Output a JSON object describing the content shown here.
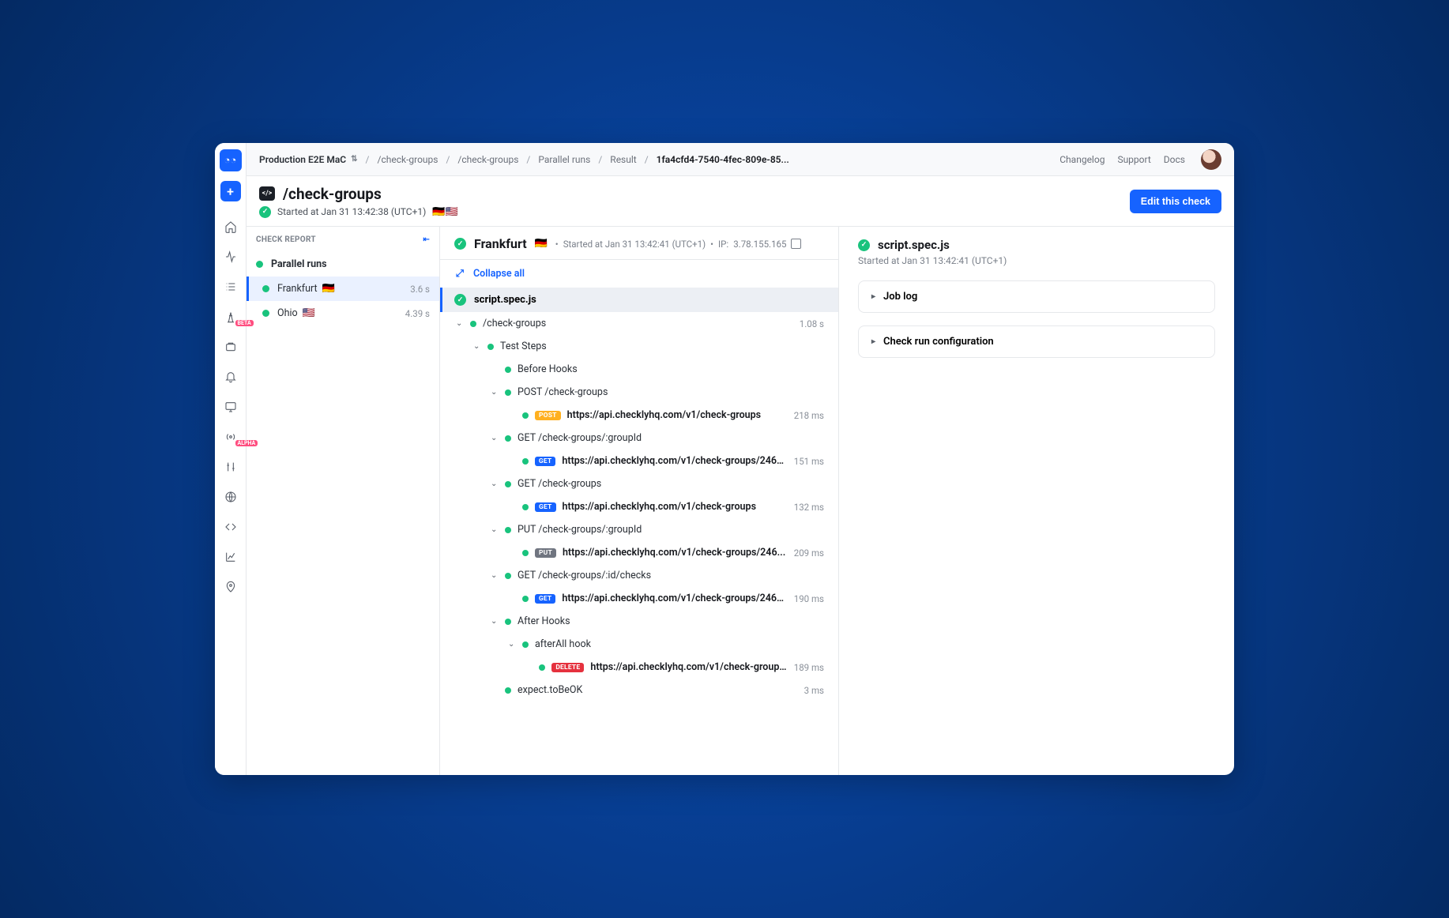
{
  "topbar": {
    "project": "Production E2E MaC",
    "crumbs": [
      "/check-groups",
      "/check-groups",
      "Parallel runs",
      "Result",
      "1fa4cfd4-7540-4fec-809e-85..."
    ],
    "links": {
      "changelog": "Changelog",
      "support": "Support",
      "docs": "Docs"
    }
  },
  "page": {
    "title": "/check-groups",
    "subtitle": "Started at Jan 31 13:42:38 (UTC+1)",
    "flags": "🇩🇪🇺🇸",
    "edit_btn": "Edit this check"
  },
  "check_report": {
    "heading": "CHECK REPORT",
    "items": [
      {
        "name": "Parallel runs",
        "dur": "",
        "type": "parent",
        "flag": ""
      },
      {
        "name": "Frankfurt",
        "dur": "3.6 s",
        "type": "child",
        "flag": "🇩🇪",
        "active": true
      },
      {
        "name": "Ohio",
        "dur": "4.39 s",
        "type": "child",
        "flag": "🇺🇸"
      }
    ]
  },
  "mid": {
    "title": "Frankfurt",
    "flag": "🇩🇪",
    "started": "Started at Jan 31 13:42:41 (UTC+1)",
    "ip_label": "IP:",
    "ip": "3.78.155.165",
    "collapse_all": "Collapse all",
    "spec": "script.spec.js",
    "tree": [
      {
        "depth": 0,
        "caret": true,
        "label": "/check-groups",
        "dur": "1.08 s"
      },
      {
        "depth": 1,
        "caret": true,
        "label": "Test Steps",
        "dur": ""
      },
      {
        "depth": 2,
        "caret": false,
        "label": "Before Hooks",
        "dur": ""
      },
      {
        "depth": 2,
        "caret": true,
        "label": "POST /check-groups",
        "dur": ""
      },
      {
        "depth": 3,
        "caret": false,
        "method": "POST",
        "url": "https://api.checklyhq.com/v1/check-groups",
        "dur": "218 ms"
      },
      {
        "depth": 2,
        "caret": true,
        "label": "GET /check-groups/:groupId",
        "dur": ""
      },
      {
        "depth": 3,
        "caret": false,
        "method": "GET",
        "url": "https://api.checklyhq.com/v1/check-groups/2464...",
        "dur": "151 ms"
      },
      {
        "depth": 2,
        "caret": true,
        "label": "GET /check-groups",
        "dur": ""
      },
      {
        "depth": 3,
        "caret": false,
        "method": "GET",
        "url": "https://api.checklyhq.com/v1/check-groups",
        "dur": "132 ms"
      },
      {
        "depth": 2,
        "caret": true,
        "label": "PUT /check-groups/:groupId",
        "dur": ""
      },
      {
        "depth": 3,
        "caret": false,
        "method": "PUT",
        "url": "https://api.checklyhq.com/v1/check-groups/246...",
        "dur": "209 ms"
      },
      {
        "depth": 2,
        "caret": true,
        "label": "GET /check-groups/:id/checks",
        "dur": ""
      },
      {
        "depth": 3,
        "caret": false,
        "method": "GET",
        "url": "https://api.checklyhq.com/v1/check-groups/2464...",
        "dur": "190 ms"
      },
      {
        "depth": 2,
        "caret": true,
        "label": "After Hooks",
        "dur": ""
      },
      {
        "depth": 3,
        "caret": true,
        "label": "afterAll hook",
        "dur": ""
      },
      {
        "depth": 4,
        "caret": false,
        "method": "DELETE",
        "url": "https://api.checklyhq.com/v1/check-groups/2...",
        "dur": "189 ms"
      },
      {
        "depth": 2,
        "caret": false,
        "label": "expect.toBeOK",
        "dur": "3 ms"
      }
    ]
  },
  "right": {
    "title": "script.spec.js",
    "started": "Started at Jan 31 13:42:41 (UTC+1)",
    "accordions": [
      "Job log",
      "Check run configuration"
    ]
  }
}
